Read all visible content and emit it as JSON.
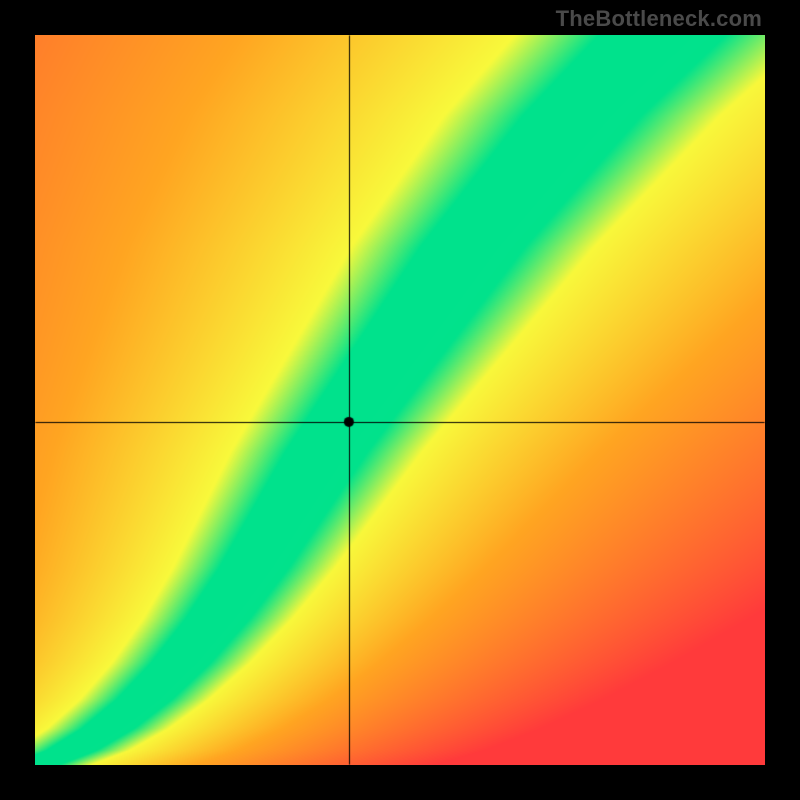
{
  "watermark": "TheBottleneck.com",
  "chart_data": {
    "type": "heatmap",
    "title": "",
    "xlabel": "",
    "ylabel": "",
    "xlim": [
      0,
      1
    ],
    "ylim": [
      0,
      1
    ],
    "crosshair": {
      "x": 0.43,
      "y": 0.47
    },
    "optimal_curve_points": [
      {
        "x": 0.0,
        "y": 0.0
      },
      {
        "x": 0.05,
        "y": 0.02
      },
      {
        "x": 0.1,
        "y": 0.05
      },
      {
        "x": 0.15,
        "y": 0.09
      },
      {
        "x": 0.2,
        "y": 0.14
      },
      {
        "x": 0.25,
        "y": 0.2
      },
      {
        "x": 0.3,
        "y": 0.27
      },
      {
        "x": 0.35,
        "y": 0.35
      },
      {
        "x": 0.4,
        "y": 0.43
      },
      {
        "x": 0.45,
        "y": 0.5
      },
      {
        "x": 0.5,
        "y": 0.57
      },
      {
        "x": 0.55,
        "y": 0.64
      },
      {
        "x": 0.6,
        "y": 0.71
      },
      {
        "x": 0.65,
        "y": 0.77
      },
      {
        "x": 0.7,
        "y": 0.83
      },
      {
        "x": 0.75,
        "y": 0.89
      },
      {
        "x": 0.8,
        "y": 0.94
      },
      {
        "x": 0.85,
        "y": 0.99
      }
    ],
    "band_half_width": 0.035,
    "color_stops": {
      "optimal": "#00E28C",
      "near": "#F8F93B",
      "mid": "#FFA521",
      "far": "#FF2E3E"
    },
    "description": "Heatmap showing bottleneck balance. Green S-shaped band is the optimal pairing; color shifts through yellow and orange to red as pairing becomes unbalanced. A black crosshair with a dot marks the user's selected configuration."
  }
}
